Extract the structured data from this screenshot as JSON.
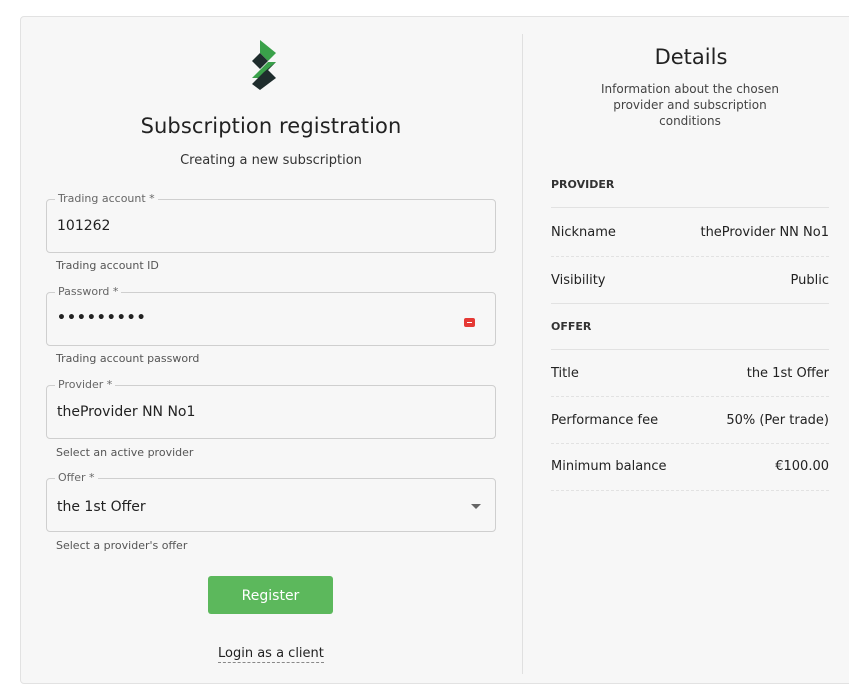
{
  "form": {
    "title": "Subscription registration",
    "subtitle": "Creating a new subscription",
    "fields": {
      "trading_account": {
        "label": "Trading account *",
        "value": "101262",
        "helper": "Trading account ID"
      },
      "password": {
        "label": "Password *",
        "value": "•••••••••",
        "helper": "Trading account password"
      },
      "provider": {
        "label": "Provider *",
        "value": "theProvider NN No1",
        "helper": "Select an active provider"
      },
      "offer": {
        "label": "Offer *",
        "value": "the 1st Offer",
        "helper": "Select a provider's offer"
      }
    },
    "register_label": "Register",
    "login_link": "Login as a client"
  },
  "details": {
    "title": "Details",
    "subtitle": "Information about the chosen provider and subscription conditions",
    "provider_heading": "PROVIDER",
    "provider_rows": [
      {
        "label": "Nickname",
        "value": "theProvider NN No1"
      },
      {
        "label": "Visibility",
        "value": "Public"
      }
    ],
    "offer_heading": "OFFER",
    "offer_rows": [
      {
        "label": "Title",
        "value": "the 1st Offer"
      },
      {
        "label": "Performance fee",
        "value": "50% (Per trade)"
      },
      {
        "label": "Minimum balance",
        "value": "€100.00"
      }
    ]
  },
  "colors": {
    "accent_green": "#5cb85c",
    "logo_green": "#3aa14a",
    "logo_dark": "#1f2d2d",
    "password_icon": "#e53935"
  }
}
